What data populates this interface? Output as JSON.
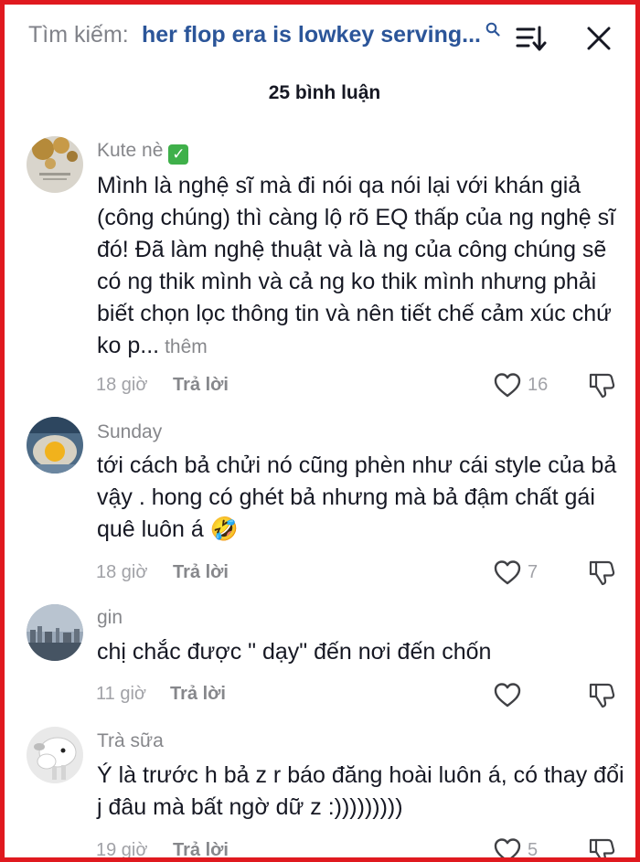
{
  "header": {
    "search_prefix": "Tìm kiếm:",
    "search_query": "her flop era is lowkey serving...",
    "search_icon": "search-icon",
    "sort_icon": "sort-icon",
    "close_icon": "close-icon"
  },
  "comment_count": "25 bình luận",
  "reply_label": "Trả lời",
  "comments": [
    {
      "username": "Kute nè",
      "verified_badge": "✓",
      "text": "Mình là nghệ sĩ mà đi nói qa nói lại với khán giả (công chúng) thì càng lộ rõ EQ thấp của ng nghệ sĩ đó! Đã làm nghệ thuật và là ng của công chúng sẽ có ng thik mình và cả ng ko thik mình nhưng phải biết chọn lọc thông tin và nên tiết chế cảm xúc chứ ko p...",
      "more": "thêm",
      "time": "18 giờ",
      "likes": "16"
    },
    {
      "username": "Sunday",
      "text": "tới cách bả chửi nó cũng phèn như cái style của bả vậy . hong có ghét bả nhưng mà bả đậm chất gái quê luôn á",
      "emoji": "🤣",
      "time": "18 giờ",
      "likes": "7"
    },
    {
      "username": "gin",
      "text": "chị chắc được \" dạy\" đến nơi đến chốn",
      "time": "11 giờ",
      "likes": ""
    },
    {
      "username": "Trà sữa",
      "text": "Ý là trước h bả z r báo đăng hoài luôn á, có thay đổi j đâu mà bất ngờ dữ z :)))))))))",
      "time": "19 giờ",
      "likes": "5"
    }
  ],
  "colors": {
    "frame_border": "#e0191f",
    "query_text": "#2b5599",
    "muted_text": "#86878b",
    "verified_green": "#3fb04a"
  }
}
